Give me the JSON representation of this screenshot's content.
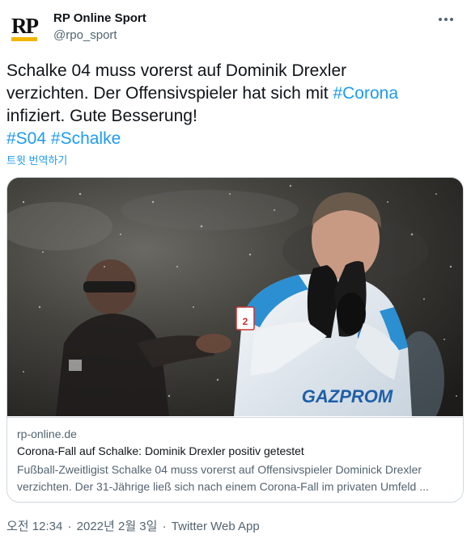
{
  "account": {
    "name": "RP Online Sport",
    "handle": "@rpo_sport",
    "avatar_text": "RP"
  },
  "tweet": {
    "line1": "Schalke 04 muss vorerst auf Dominik Drexler",
    "line2_text": "verzichten. Der Offensivspieler hat sich mit ",
    "line2_tag": "#Corona",
    "line3": "infiziert. Gute Besserung!",
    "tag1": "#S04",
    "tag2": "#Schalke",
    "translate_label": "트윗 번역하기"
  },
  "card": {
    "domain": "rp-online.de",
    "title": "Corona-Fall auf Schalke: Dominik Drexler positiv getestet",
    "desc_line1": "Fußball-Zweitligist Schalke 04 muss vorerst auf Offensivspieler Dominick Drexler",
    "desc_line2": "verzichten. Der 31-Jährige ließ sich nach einem Corona-Fall im privaten Umfeld ...",
    "image": {
      "shirt_sponsor": "GAZPROM",
      "badge_number": "2"
    }
  },
  "meta": {
    "time": "오전 12:34",
    "date": "2022년 2월 3일",
    "separator": "·",
    "client": "Twitter Web App"
  },
  "colors": {
    "link": "#1d9bf0",
    "secondary": "#536471",
    "border": "#cfd9de",
    "avatar_accent": "#f2b600"
  }
}
